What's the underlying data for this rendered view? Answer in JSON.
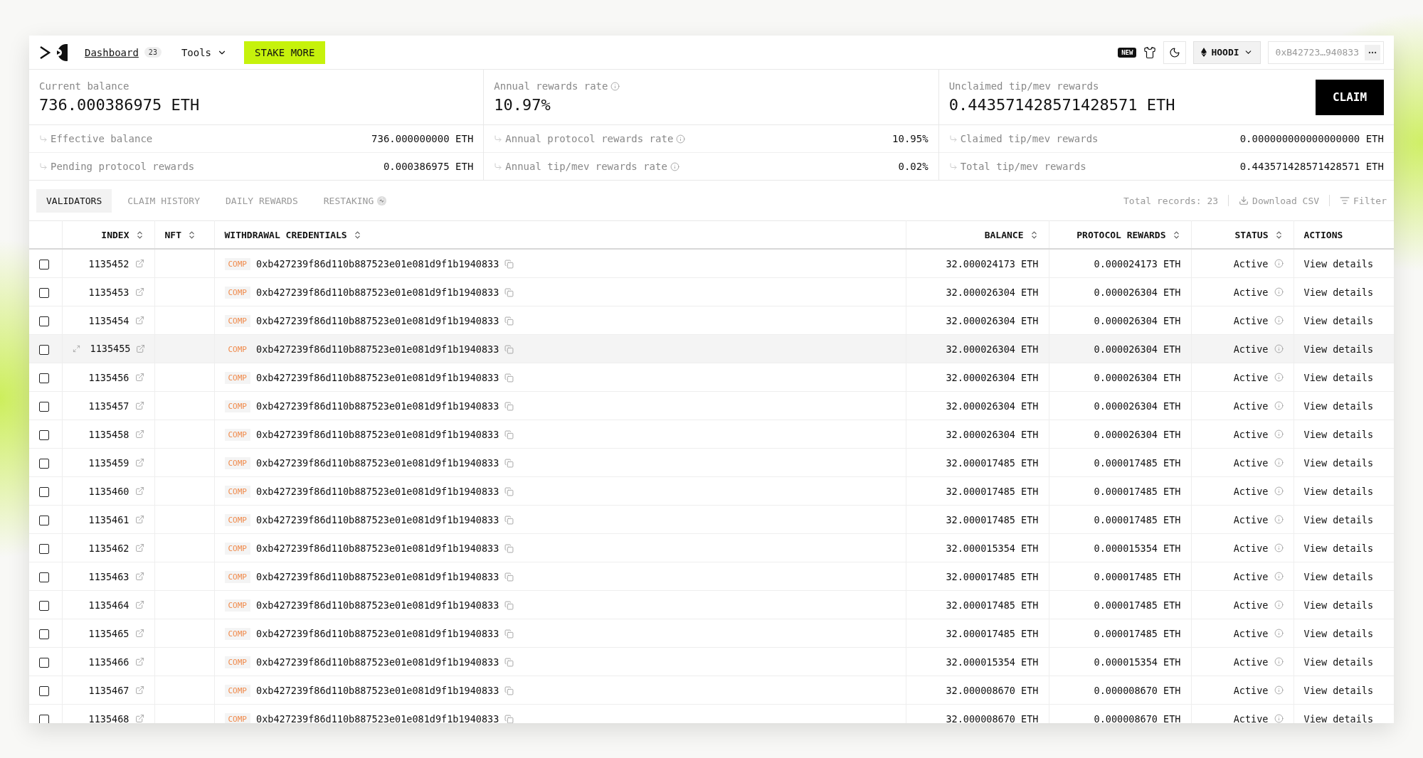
{
  "header": {
    "nav": [
      {
        "kind": "link",
        "label": "Dashboard",
        "badge": "23"
      },
      {
        "kind": "menu",
        "label": "Tools"
      }
    ],
    "stake_button": "STAKE MORE",
    "new_badge": "NEW",
    "network": "HOODI",
    "wallet": "0xB42723…940833"
  },
  "stats": [
    {
      "label": "Current balance",
      "info": false,
      "value": "736.000386975 ETH",
      "sub": [
        {
          "label": "Effective balance",
          "info": false,
          "value": "736.000000000 ETH"
        },
        {
          "label": "Pending protocol rewards",
          "info": false,
          "value": "0.000386975 ETH"
        }
      ]
    },
    {
      "label": "Annual rewards rate",
      "info": true,
      "value": "10.97%",
      "sub": [
        {
          "label": "Annual protocol rewards rate",
          "info": true,
          "value": "10.95%"
        },
        {
          "label": "Annual tip/mev rewards rate",
          "info": true,
          "value": "0.02%"
        }
      ]
    },
    {
      "label": "Unclaimed tip/mev rewards",
      "info": false,
      "value": "0.443571428571428571 ETH",
      "action": "CLAIM",
      "sub": [
        {
          "label": "Claimed tip/mev rewards",
          "info": false,
          "value": "0.000000000000000000 ETH"
        },
        {
          "label": "Total tip/mev rewards",
          "info": false,
          "value": "0.443571428571428571 ETH"
        }
      ]
    }
  ],
  "tabs": [
    {
      "label": "VALIDATORS",
      "selected": true,
      "icon": false
    },
    {
      "label": "CLAIM HISTORY",
      "selected": false,
      "icon": false
    },
    {
      "label": "DAILY REWARDS",
      "selected": false,
      "icon": false
    },
    {
      "label": "RESTAKING",
      "selected": false,
      "icon": true
    }
  ],
  "toolbar": {
    "total_records": "Total records: 23",
    "download": "Download CSV",
    "filter": "Filter"
  },
  "table": {
    "columns": [
      {
        "label": "INDEX",
        "sortable": true
      },
      {
        "label": "NFT",
        "sortable": true
      },
      {
        "label": "WITHDRAWAL CREDENTIALS",
        "sortable": true
      },
      {
        "label": "BALANCE",
        "sortable": true
      },
      {
        "label": "PROTOCOL REWARDS",
        "sortable": true
      },
      {
        "label": "STATUS",
        "sortable": true
      },
      {
        "label": "ACTIONS",
        "sortable": false
      }
    ],
    "rows": [
      {
        "checked": false,
        "highlighted": false,
        "index": "1135452",
        "badge": "COMP",
        "credentials": "0xb427239f86d110b887523e01e081d9f1b1940833",
        "balance": "32.000024173 ETH",
        "protocol_rewards": "0.000024173 ETH",
        "status": "Active",
        "action": "View details"
      },
      {
        "checked": false,
        "highlighted": false,
        "index": "1135453",
        "badge": "COMP",
        "credentials": "0xb427239f86d110b887523e01e081d9f1b1940833",
        "balance": "32.000026304 ETH",
        "protocol_rewards": "0.000026304 ETH",
        "status": "Active",
        "action": "View details"
      },
      {
        "checked": false,
        "highlighted": false,
        "index": "1135454",
        "badge": "COMP",
        "credentials": "0xb427239f86d110b887523e01e081d9f1b1940833",
        "balance": "32.000026304 ETH",
        "protocol_rewards": "0.000026304 ETH",
        "status": "Active",
        "action": "View details"
      },
      {
        "checked": false,
        "highlighted": true,
        "index": "1135455",
        "badge": "COMP",
        "credentials": "0xb427239f86d110b887523e01e081d9f1b1940833",
        "balance": "32.000026304 ETH",
        "protocol_rewards": "0.000026304 ETH",
        "status": "Active",
        "action": "View details"
      },
      {
        "checked": false,
        "highlighted": false,
        "index": "1135456",
        "badge": "COMP",
        "credentials": "0xb427239f86d110b887523e01e081d9f1b1940833",
        "balance": "32.000026304 ETH",
        "protocol_rewards": "0.000026304 ETH",
        "status": "Active",
        "action": "View details"
      },
      {
        "checked": false,
        "highlighted": false,
        "index": "1135457",
        "badge": "COMP",
        "credentials": "0xb427239f86d110b887523e01e081d9f1b1940833",
        "balance": "32.000026304 ETH",
        "protocol_rewards": "0.000026304 ETH",
        "status": "Active",
        "action": "View details"
      },
      {
        "checked": false,
        "highlighted": false,
        "index": "1135458",
        "badge": "COMP",
        "credentials": "0xb427239f86d110b887523e01e081d9f1b1940833",
        "balance": "32.000026304 ETH",
        "protocol_rewards": "0.000026304 ETH",
        "status": "Active",
        "action": "View details"
      },
      {
        "checked": false,
        "highlighted": false,
        "index": "1135459",
        "badge": "COMP",
        "credentials": "0xb427239f86d110b887523e01e081d9f1b1940833",
        "balance": "32.000017485 ETH",
        "protocol_rewards": "0.000017485 ETH",
        "status": "Active",
        "action": "View details"
      },
      {
        "checked": false,
        "highlighted": false,
        "index": "1135460",
        "badge": "COMP",
        "credentials": "0xb427239f86d110b887523e01e081d9f1b1940833",
        "balance": "32.000017485 ETH",
        "protocol_rewards": "0.000017485 ETH",
        "status": "Active",
        "action": "View details"
      },
      {
        "checked": false,
        "highlighted": false,
        "index": "1135461",
        "badge": "COMP",
        "credentials": "0xb427239f86d110b887523e01e081d9f1b1940833",
        "balance": "32.000017485 ETH",
        "protocol_rewards": "0.000017485 ETH",
        "status": "Active",
        "action": "View details"
      },
      {
        "checked": false,
        "highlighted": false,
        "index": "1135462",
        "badge": "COMP",
        "credentials": "0xb427239f86d110b887523e01e081d9f1b1940833",
        "balance": "32.000015354 ETH",
        "protocol_rewards": "0.000015354 ETH",
        "status": "Active",
        "action": "View details"
      },
      {
        "checked": false,
        "highlighted": false,
        "index": "1135463",
        "badge": "COMP",
        "credentials": "0xb427239f86d110b887523e01e081d9f1b1940833",
        "balance": "32.000017485 ETH",
        "protocol_rewards": "0.000017485 ETH",
        "status": "Active",
        "action": "View details"
      },
      {
        "checked": false,
        "highlighted": false,
        "index": "1135464",
        "badge": "COMP",
        "credentials": "0xb427239f86d110b887523e01e081d9f1b1940833",
        "balance": "32.000017485 ETH",
        "protocol_rewards": "0.000017485 ETH",
        "status": "Active",
        "action": "View details"
      },
      {
        "checked": false,
        "highlighted": false,
        "index": "1135465",
        "badge": "COMP",
        "credentials": "0xb427239f86d110b887523e01e081d9f1b1940833",
        "balance": "32.000017485 ETH",
        "protocol_rewards": "0.000017485 ETH",
        "status": "Active",
        "action": "View details"
      },
      {
        "checked": false,
        "highlighted": false,
        "index": "1135466",
        "badge": "COMP",
        "credentials": "0xb427239f86d110b887523e01e081d9f1b1940833",
        "balance": "32.000015354 ETH",
        "protocol_rewards": "0.000015354 ETH",
        "status": "Active",
        "action": "View details"
      },
      {
        "checked": false,
        "highlighted": false,
        "index": "1135467",
        "badge": "COMP",
        "credentials": "0xb427239f86d110b887523e01e081d9f1b1940833",
        "balance": "32.000008670 ETH",
        "protocol_rewards": "0.000008670 ETH",
        "status": "Active",
        "action": "View details"
      },
      {
        "checked": false,
        "highlighted": false,
        "index": "1135468",
        "badge": "COMP",
        "credentials": "0xb427239f86d110b887523e01e081d9f1b1940833",
        "balance": "32.000008670 ETH",
        "protocol_rewards": "0.000008670 ETH",
        "status": "Active",
        "action": "View details"
      }
    ]
  }
}
